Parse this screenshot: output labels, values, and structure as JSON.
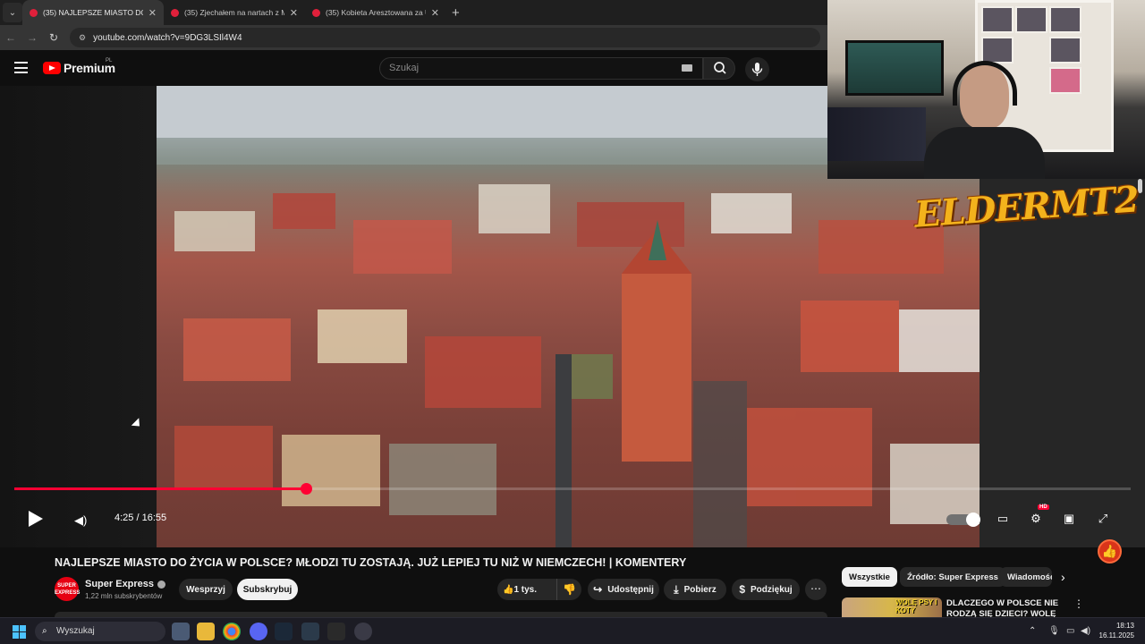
{
  "browser": {
    "tabs": [
      {
        "label": "(35) NAJLEPSZE MIASTO DO ŻYCIA",
        "active": true
      },
      {
        "label": "(35) Zjechałem na nartach z Mo",
        "active": false
      },
      {
        "label": "(35) Kobieta Aresztowana za Uj",
        "active": false
      }
    ],
    "url": "youtube.com/watch?v=9DG3LSIl4W4"
  },
  "youtube": {
    "logo": "Premium",
    "region": "PL",
    "search_placeholder": "Szukaj"
  },
  "player": {
    "current_time": "4:25",
    "separator": " / ",
    "duration": "16:55",
    "progress_fraction": 0.261,
    "quality_badge": "HD",
    "overlay_brand": "ELDERMT2"
  },
  "video": {
    "title": "NAJLEPSZE MIASTO DO ŻYCIA W POLSCE? MŁODZI TU ZOSTAJĄ. JUŻ LEPIEJ TU NIŻ W NIEMCZECH! | KOMENTERY",
    "channel_name": "Super Express",
    "channel_avatar_text": "SUPER EXPRESS",
    "subscribers": "1,22 mln subskrybentów",
    "support_label": "Wesprzyj",
    "subscribe_label": "Subskrybuj",
    "likes": "1 tys.",
    "share_label": "Udostępnij",
    "download_label": "Pobierz",
    "thanks_label": "Podziękuj"
  },
  "sidebar": {
    "chips": [
      "Wszystkie",
      "Źródło: Super Express",
      "Wiadomości"
    ],
    "recommendation": {
      "title": "DLACZEGO W POLSCE NIE RODZĄ SIĘ DZIECI? WOLĘ PSY",
      "thumb_text": "WOLĘ PSY I KOTY"
    }
  },
  "taskbar": {
    "search_label": "Wyszukaj",
    "time": "18:13",
    "date": "16.11.2025"
  },
  "colors": {
    "youtube_red": "#ff0000",
    "progress_red": "#ff0033",
    "windows_accent": "#4cc2ff"
  }
}
